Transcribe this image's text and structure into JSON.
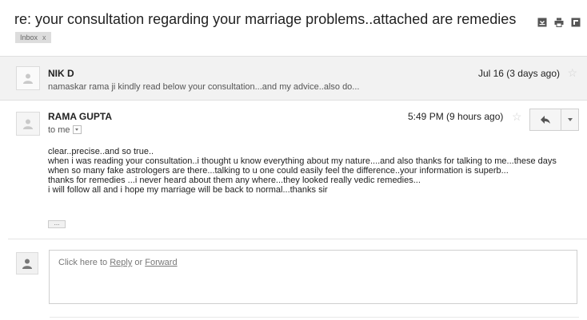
{
  "thread": {
    "subject": "re: your consultation regarding your marriage problems..attached are remedies",
    "label": "Inbox",
    "label_remove": "x"
  },
  "toolbar_icons": [
    "archive-icon",
    "print-icon",
    "new-window-icon"
  ],
  "message1": {
    "sender": "NIK D",
    "date": "Jul 16 (3 days ago)",
    "snippet": "namaskar rama ji kindly read below your consultation...and my advice..also do..."
  },
  "message2": {
    "sender": "RAMA GUPTA",
    "recipient": "to me",
    "date": "5:49 PM (9 hours ago)",
    "body": [
      "clear..precise..and so true..",
      "when i was reading your consultation..i thought u know everything about my nature....and also thanks  for talking to me...these days when so many fake astrologers are there...talking to u one could easily feel the difference..your information is superb...",
      "thanks for remedies ...i never heard about them any where...they looked really vedic remedies...",
      "i will follow all and i hope my marriage will be back to normal...thanks sir"
    ],
    "ellipsis": "..."
  },
  "reply_box": {
    "prefix": "Click here to",
    "reply": "Reply",
    "or": "or",
    "forward": "Forward"
  },
  "colors": {
    "collapsed_bg": "#f2f2f2",
    "star": "#d2d2d2",
    "text": "#222222",
    "muted": "#555555"
  }
}
